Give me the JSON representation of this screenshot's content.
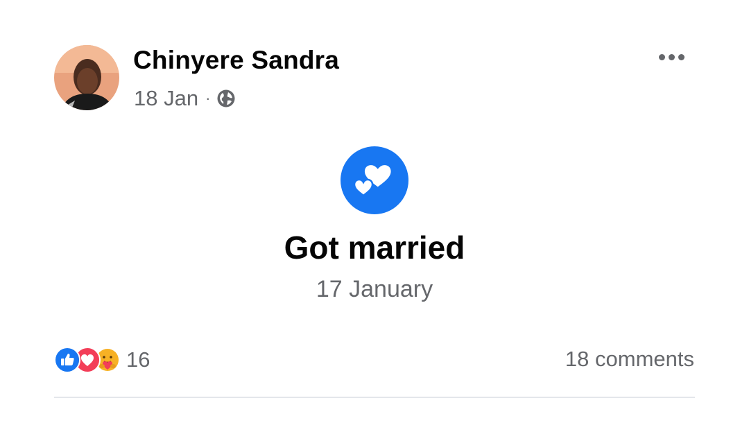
{
  "post": {
    "author": {
      "name": "Chinyere Sandra"
    },
    "timestamp": "18 Jan",
    "separator": "·",
    "audience_icon": "globe-icon",
    "more_icon": "more-options-icon",
    "life_event": {
      "icon": "hearts-icon",
      "icon_color": "#1877f2",
      "title": "Got married",
      "date": "17 January"
    },
    "footer": {
      "reactions": [
        "like-reaction-icon",
        "love-reaction-icon",
        "care-reaction-icon"
      ],
      "reaction_count": "16",
      "comments_label": "18 comments"
    }
  },
  "colors": {
    "accent": "#1877f2",
    "secondary_text": "#65676b",
    "love": "#f33e58",
    "care": "#f7b125"
  }
}
